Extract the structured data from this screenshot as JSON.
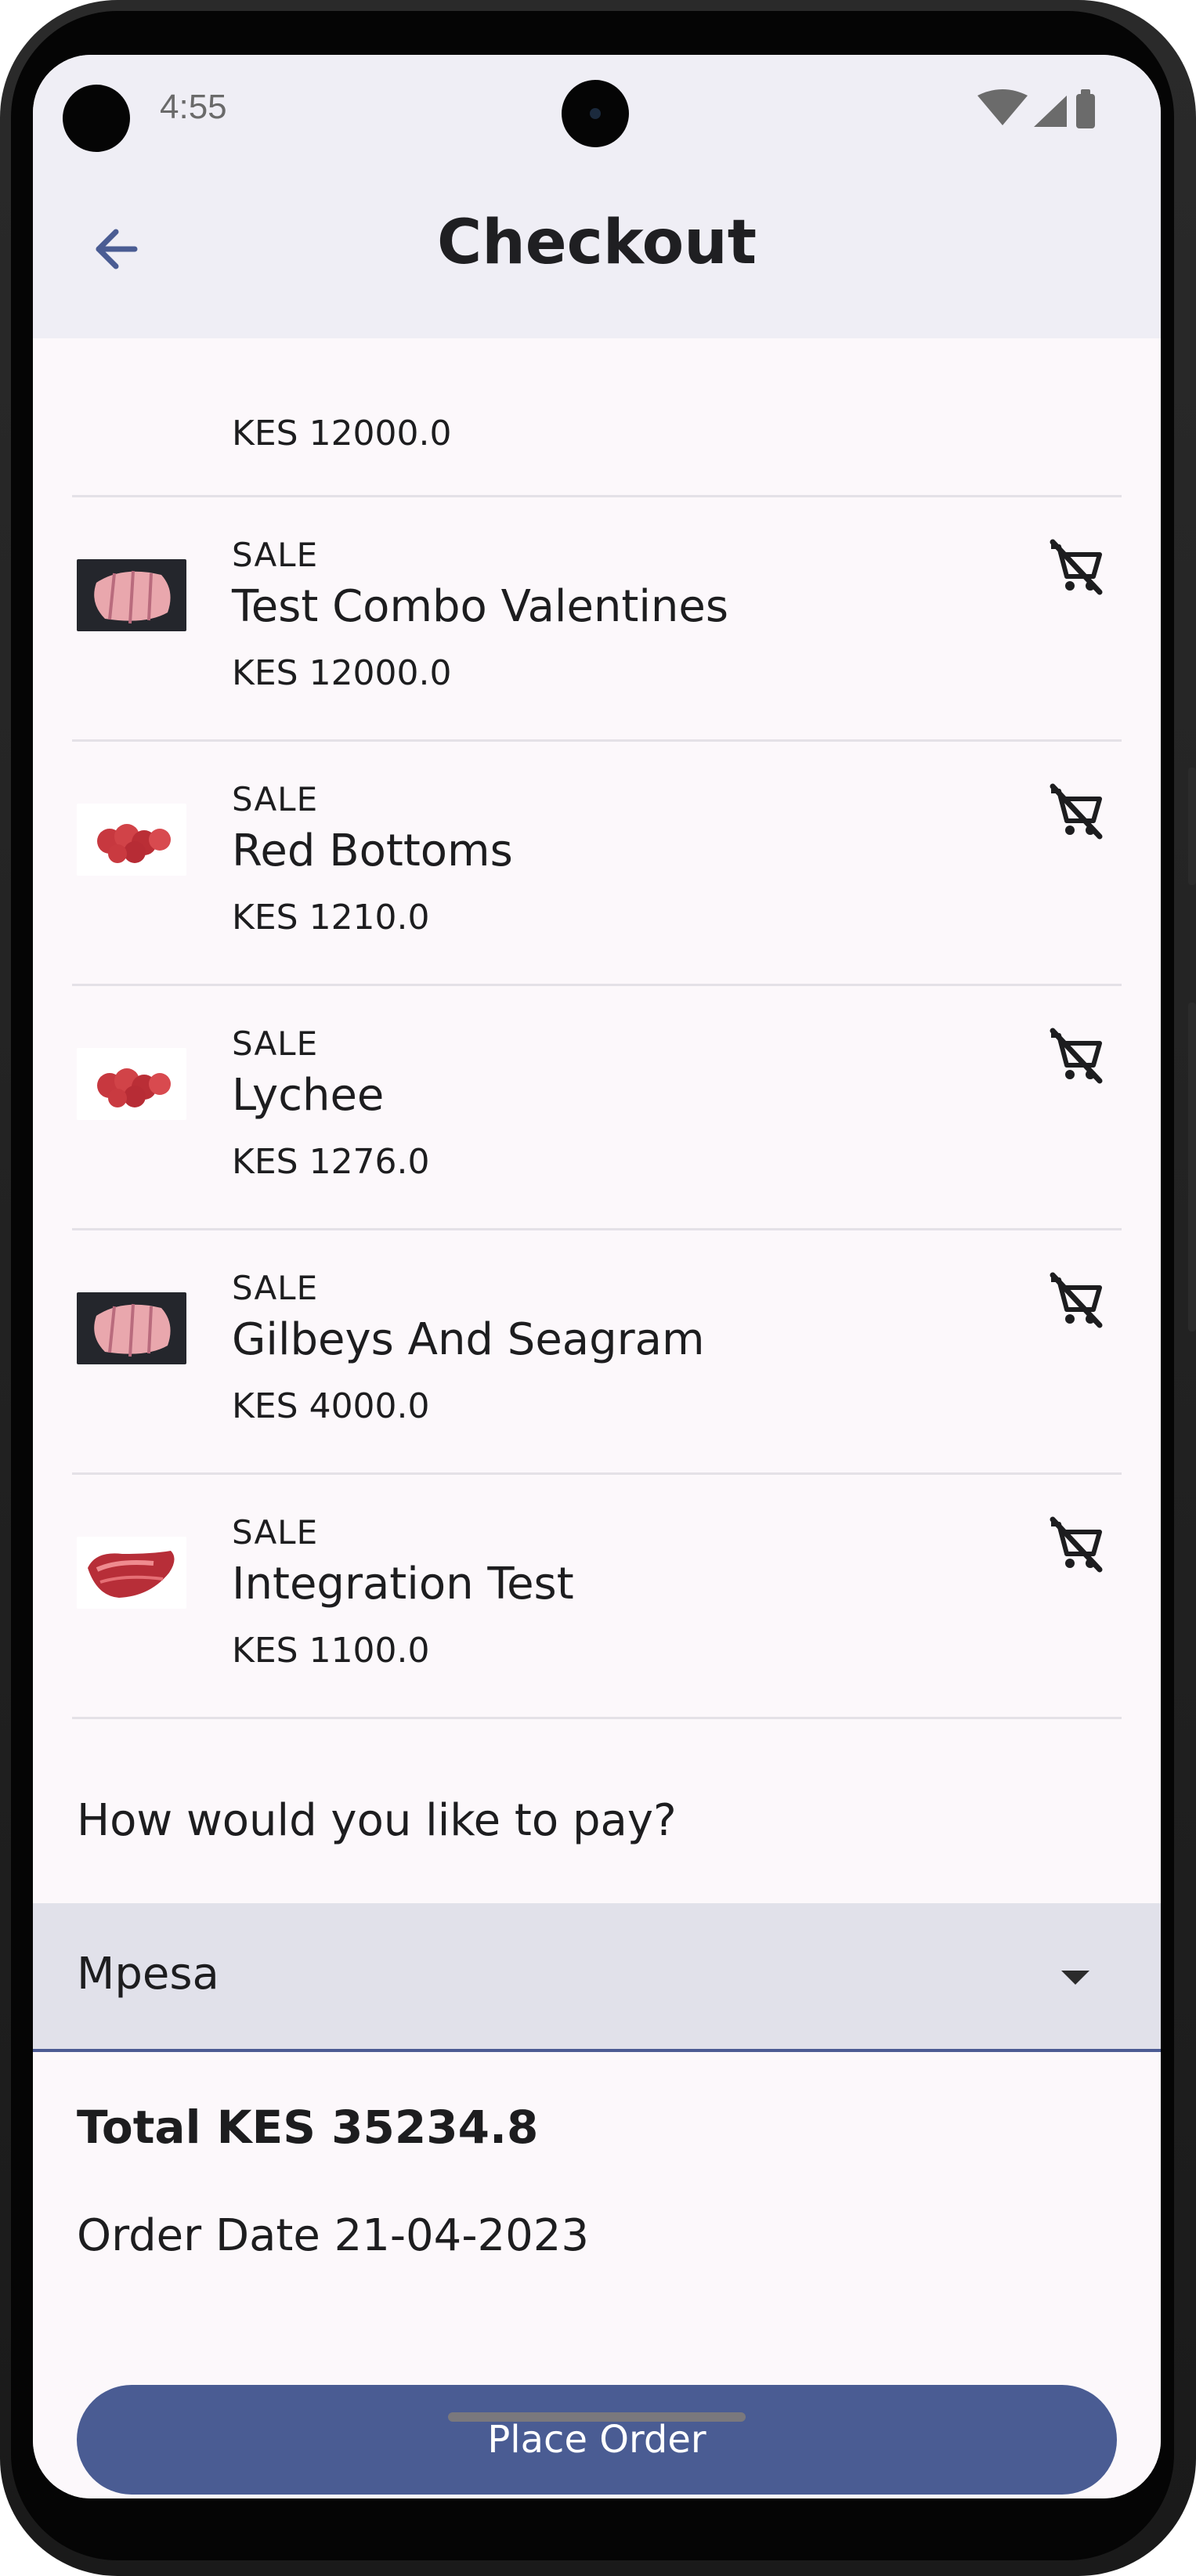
{
  "status": {
    "time": "4:55"
  },
  "header": {
    "title": "Checkout"
  },
  "cart": {
    "top_price": "KES 12000.0",
    "items": [
      {
        "label": "SALE",
        "name": "Test Combo Valentines",
        "price": "KES 12000.0",
        "thumb_icon": "meat-icon"
      },
      {
        "label": "SALE",
        "name": "Red Bottoms",
        "price": "KES 1210.0",
        "thumb_icon": "fruit-icon"
      },
      {
        "label": "SALE",
        "name": "Lychee",
        "price": "KES 1276.0",
        "thumb_icon": "fruit-icon"
      },
      {
        "label": "SALE",
        "name": "Gilbeys And Seagram",
        "price": "KES 4000.0",
        "thumb_icon": "meat-icon"
      },
      {
        "label": "SALE",
        "name": "Integration Test",
        "price": "KES 1100.0",
        "thumb_icon": "steak-icon"
      }
    ]
  },
  "payment": {
    "question": "How would you like to pay?",
    "selected": "Mpesa"
  },
  "summary": {
    "total": "Total KES 35234.8",
    "order_date": "Order Date 21-04-2023"
  },
  "actions": {
    "place_order": "Place Order"
  },
  "colors": {
    "accent": "#4a5c93",
    "appbar": "#efeef5",
    "background": "#fcf8fb"
  }
}
